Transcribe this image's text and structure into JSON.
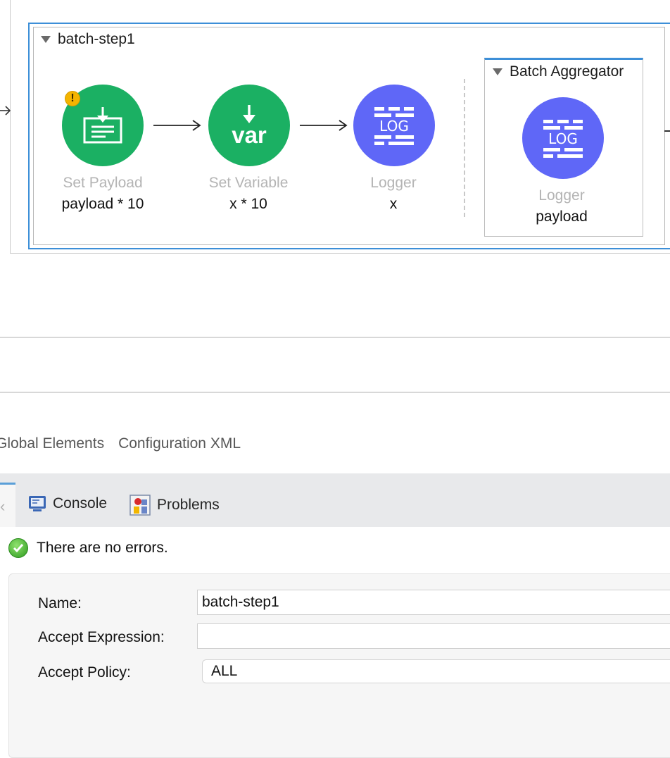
{
  "canvas": {
    "batch_step": {
      "title": "batch-step1",
      "nodes": [
        {
          "name": "Set Payload",
          "value": "payload * 10",
          "icon": "set-payload-icon",
          "color": "#1bb063",
          "warning": "!"
        },
        {
          "name": "Set Variable",
          "value": "x * 10",
          "icon": "set-variable-icon",
          "icon_text": "var",
          "color": "#1bb063"
        },
        {
          "name": "Logger",
          "value": "x",
          "icon": "logger-icon",
          "icon_text": "LOG",
          "color": "#5f67f7"
        }
      ],
      "aggregator": {
        "title": "Batch Aggregator",
        "node": {
          "name": "Logger",
          "value": "payload",
          "icon": "logger-icon",
          "icon_text": "LOG",
          "color": "#5f67f7"
        }
      }
    }
  },
  "editor_tabs": [
    "Global Elements",
    "Configuration XML"
  ],
  "panel": {
    "tabs": [
      {
        "label": "Console",
        "icon": "console-icon"
      },
      {
        "label": "Problems",
        "icon": "problems-icon"
      }
    ],
    "status": "There are no errors.",
    "fields": {
      "name_label": "Name:",
      "name_value": "batch-step1",
      "accept_expression_label": "Accept Expression:",
      "accept_expression_value": "",
      "accept_policy_label": "Accept Policy:",
      "accept_policy_value": "ALL"
    }
  },
  "colors": {
    "accent": "#3d8fd8",
    "green": "#1bb063",
    "purple": "#5f67f7"
  }
}
